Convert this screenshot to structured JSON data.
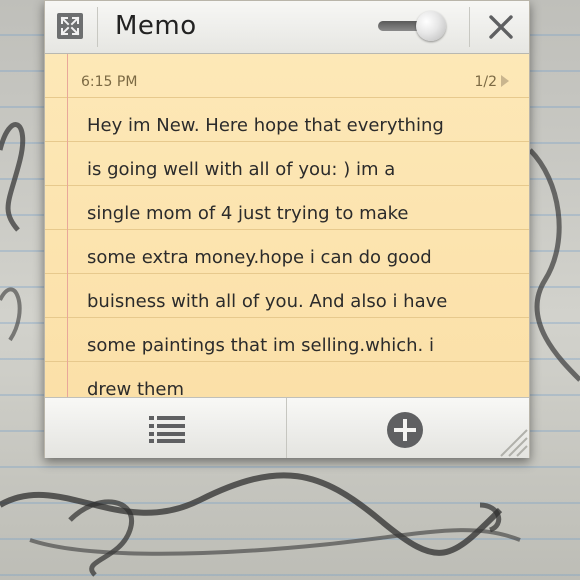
{
  "window": {
    "title": "Memo"
  },
  "note": {
    "timestamp": "6:15 PM",
    "page_indicator": "1/2",
    "lines": [
      "Hey im New. Here hope that everything",
      "is going well with all of you: ) im a",
      "single mom of 4 just trying to make",
      "some extra money.hope i can do good",
      "buisness with all of you. And also i have",
      "some paintings  that im selling.which. i",
      "drew them"
    ]
  },
  "icons": {
    "expand": "expand-icon",
    "close": "close-icon",
    "list": "list-icon",
    "add": "add-icon",
    "resize": "resize-grip-icon"
  },
  "colors": {
    "paper": "#fbe3ad",
    "rule_line": "#e7c98d",
    "margin_line": "#e8a79a",
    "text": "#2b2b2b",
    "icon_gray": "#5f6062"
  }
}
